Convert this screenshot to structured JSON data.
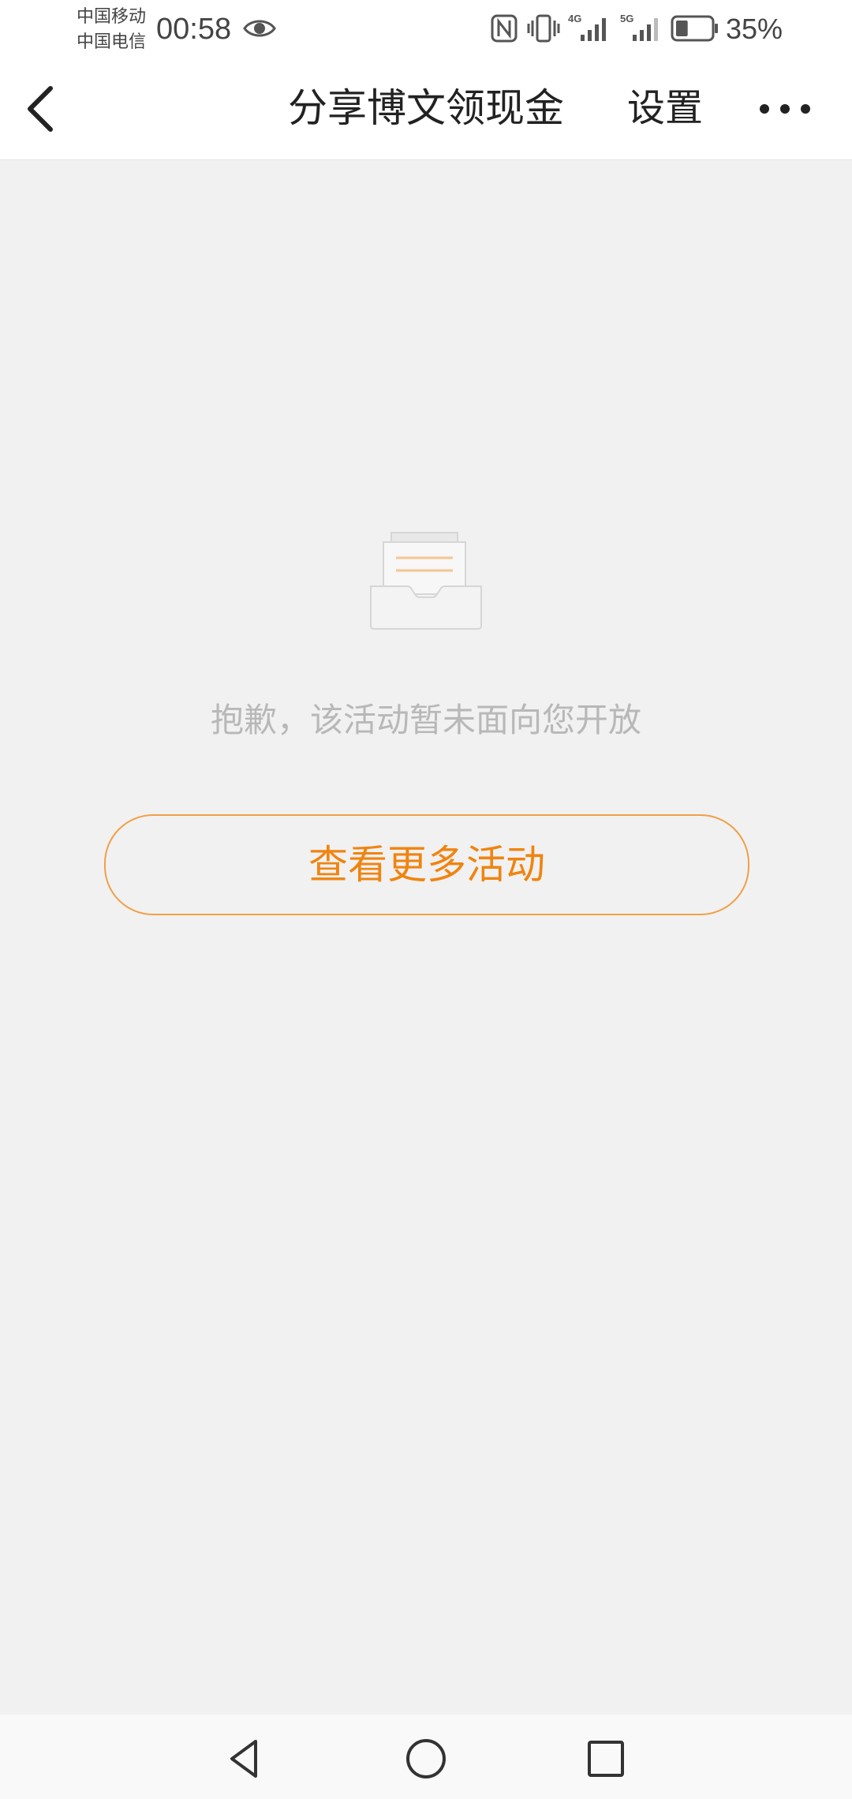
{
  "status_bar": {
    "carrier_1": "中国移动",
    "carrier_2": "中国电信",
    "time": "00:58",
    "network_1": "4G",
    "network_2": "5G",
    "battery_percent": "35%",
    "battery_level": 0.35
  },
  "header": {
    "title": "分享博文领现金",
    "settings_label": "设置"
  },
  "main": {
    "empty_message": "抱歉，该活动暂未面向您开放",
    "more_button_label": "查看更多活动"
  },
  "colors": {
    "accent": "#f08410",
    "accent_border": "#f0a048",
    "background": "#f1f1f1",
    "muted_text": "#b8b8b8"
  },
  "icons": {
    "back": "chevron-left-icon",
    "more": "more-dots-icon",
    "empty": "empty-inbox-icon",
    "nav_back": "nav-back-triangle-icon",
    "nav_home": "nav-home-circle-icon",
    "nav_recent": "nav-recent-square-icon"
  }
}
